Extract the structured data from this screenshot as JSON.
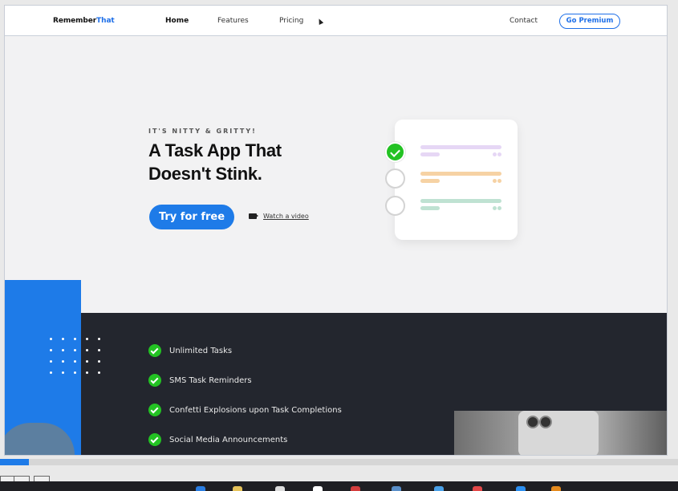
{
  "nav": {
    "logo_main": "Remember",
    "logo_accent": "That",
    "links": [
      "Home",
      "Features",
      "Pricing",
      "Contact"
    ],
    "premium": "Go Premium"
  },
  "hero": {
    "eyebrow": "IT'S NITTY & GRITTY!",
    "headline": "A Task App That Doesn't Stink.",
    "cta": "Try for free",
    "video_label": "Watch a video"
  },
  "task_card": {
    "tasks": [
      {
        "done": true,
        "color": "#e6d7f5"
      },
      {
        "done": false,
        "color": "#f6d2a4"
      },
      {
        "done": false,
        "color": "#bfe2d2"
      }
    ]
  },
  "features": [
    "Unlimited Tasks",
    "SMS Task Reminders",
    "Confetti Explosions upon Task Completions",
    "Social Media Announcements"
  ],
  "video_progress": 0.043,
  "colors": {
    "accent": "#1e7be8",
    "check": "#23c223",
    "dark": "#23262e"
  },
  "icons": {
    "feature_check": "check-circle-icon",
    "video": "video-camera-icon"
  }
}
